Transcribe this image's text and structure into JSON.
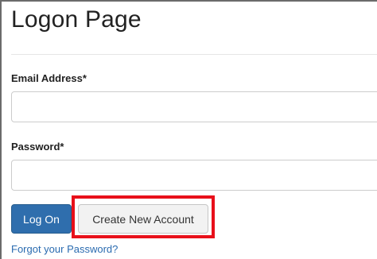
{
  "page": {
    "title": "Logon Page"
  },
  "form": {
    "email_label": "Email Address*",
    "email_value": "",
    "password_label": "Password*",
    "password_value": "",
    "logon_button": "Log On",
    "create_account_button": "Create New Account",
    "forgot_password_link": "Forgot your Password?"
  },
  "colors": {
    "primary_button": "#2f6ead",
    "highlight": "#e8101a",
    "link": "#2a6bb0"
  }
}
